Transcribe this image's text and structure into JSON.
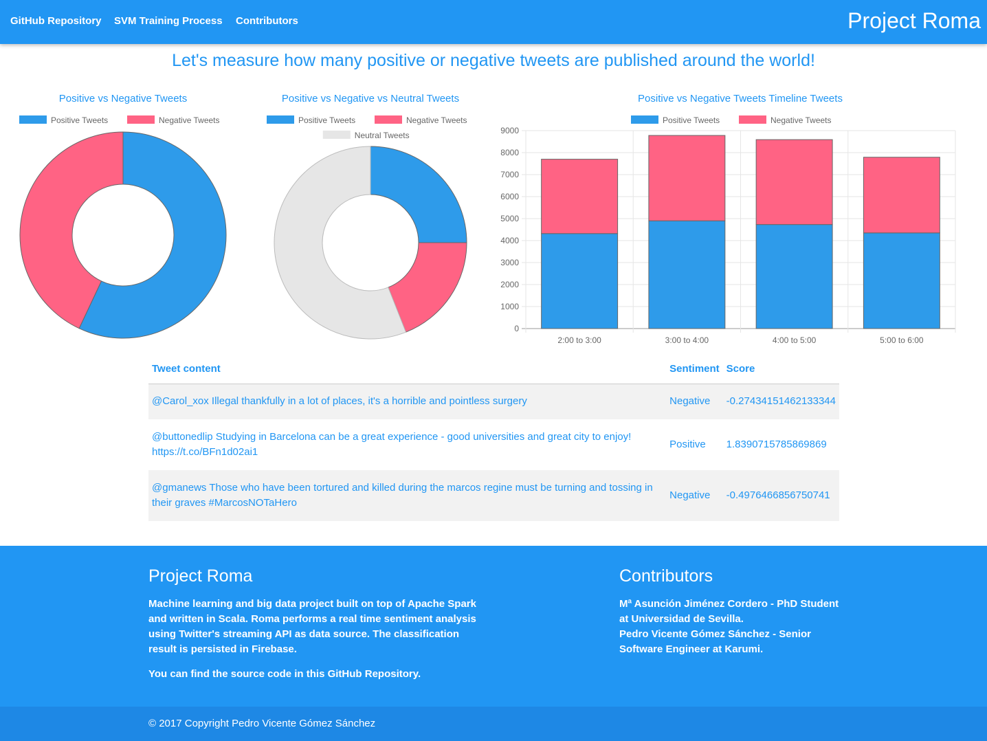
{
  "nav": {
    "links": [
      "GitHub Repository",
      "SVM Training Process",
      "Contributors"
    ],
    "brand": "Project Roma"
  },
  "headline": "Let's measure how many positive or negative tweets are published around the world!",
  "colors": {
    "primary": "#2196F3",
    "positive": "#2E9BEA",
    "negative": "#FF6384",
    "neutral": "#E6E6E6"
  },
  "chart_data": [
    {
      "type": "pie",
      "title": "Positive vs Negative Tweets",
      "legend": [
        "Positive Tweets",
        "Negative Tweets"
      ],
      "legend_position": "top",
      "series": [
        {
          "name": "Positive Tweets",
          "value": 57
        },
        {
          "name": "Negative Tweets",
          "value": 43
        }
      ]
    },
    {
      "type": "pie",
      "title": "Positive vs Negative vs Neutral Tweets",
      "legend": [
        "Positive Tweets",
        "Negative Tweets",
        "Neutral Tweets"
      ],
      "legend_position": "top",
      "series": [
        {
          "name": "Positive Tweets",
          "value": 25
        },
        {
          "name": "Negative Tweets",
          "value": 19
        },
        {
          "name": "Neutral Tweets",
          "value": 56
        }
      ]
    },
    {
      "type": "bar",
      "stacked": true,
      "title": "Positive vs Negative Tweets Timeline Tweets",
      "legend": [
        "Positive Tweets",
        "Negative Tweets"
      ],
      "legend_position": "top",
      "categories": [
        "2:00 to 3:00",
        "3:00 to 4:00",
        "4:00 to 5:00",
        "5:00 to 6:00"
      ],
      "series": [
        {
          "name": "Positive Tweets",
          "values": [
            4320,
            4900,
            4730,
            4350
          ]
        },
        {
          "name": "Negative Tweets",
          "values": [
            3380,
            3880,
            3860,
            3440
          ]
        }
      ],
      "ylim": [
        0,
        9000
      ],
      "yticks": [
        "0",
        "1000",
        "2000",
        "3000",
        "4000",
        "5000",
        "6000",
        "7000",
        "8000",
        "9000"
      ],
      "grid": true
    }
  ],
  "table": {
    "headers": [
      "Tweet content",
      "Sentiment",
      "Score"
    ],
    "rows": [
      {
        "content": "@Carol_xox Illegal thankfully in a lot of places, it's a horrible and pointless surgery",
        "sentiment": "Negative",
        "score": "-0.27434151462133344"
      },
      {
        "content": "@buttonedlip Studying in Barcelona can be a great experience - good universities and great city to enjoy! https://t.co/BFn1d02ai1",
        "sentiment": "Positive",
        "score": "1.8390715785869869"
      },
      {
        "content": "@gmanews Those who have been tortured and killed during the marcos regine must be turning and tossing in their graves #MarcosNOTaHero",
        "sentiment": "Negative",
        "score": "-0.4976466856750741"
      }
    ]
  },
  "footer": {
    "about_title": "Project Roma",
    "about_text": "Machine learning and big data project built on top of Apache Spark and written in Scala. Roma performs a real time sentiment analysis using Twitter's streaming API as data source. The classification result is persisted in Firebase.",
    "source_text": "You can find the source code in this GitHub Repository.",
    "contributors_title": "Contributors",
    "contributor_1": "Mª Asunción Jiménez Cordero - PhD Student at Universidad de Sevilla.",
    "contributor_2": "Pedro Vicente Gómez Sánchez - Senior Software Engineer at Karumi.",
    "copyright": "© 2017 Copyright Pedro Vicente Gómez Sánchez"
  }
}
